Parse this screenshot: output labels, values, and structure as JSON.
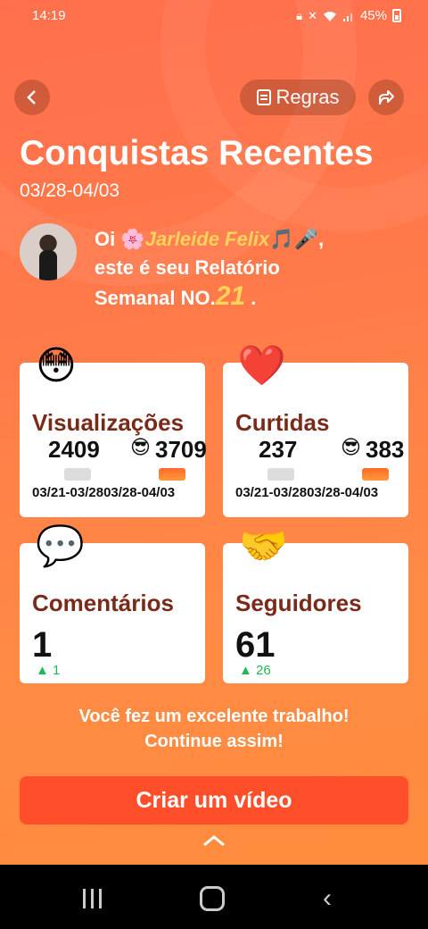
{
  "status_bar": {
    "time": "14:19",
    "battery": "45%",
    "icons": [
      "lock-icon",
      "mute-icon",
      "wifi-icon",
      "signal-icon",
      "battery-icon"
    ]
  },
  "nav": {
    "back_icon": "chevron-left-icon",
    "rules_label": "Regras",
    "share_icon": "share-icon"
  },
  "header": {
    "title": "Conquistas Recentes",
    "date_range": "03/28-04/03"
  },
  "greeting": {
    "hi": "Oi",
    "flower": "🌸",
    "name": "Jarleide Felix",
    "name_emojis": "🎵🎤",
    "comma": ",",
    "line2": "este é seu Relatório",
    "line3_prefix": "Semanal NO.",
    "week_number": "21",
    "period": "."
  },
  "cards": {
    "views": {
      "emoji": "😳",
      "label": "Visualizações",
      "prev": "2409",
      "curr_emoji": "😎",
      "curr": "3709",
      "dates": "03/21-03/2803/28-04/03"
    },
    "likes": {
      "emoji": "❤️",
      "label": "Curtidas",
      "prev": "237",
      "curr_emoji": "😎",
      "curr": "383",
      "dates": "03/21-03/2803/28-04/03"
    },
    "comments": {
      "emoji": "💬",
      "label": "Comentários",
      "value": "1",
      "delta": "▲ 1"
    },
    "followers": {
      "emoji": "🤝",
      "label": "Seguidores",
      "value": "61",
      "delta": "▲ 26"
    }
  },
  "message": {
    "line1": "Você fez um excelente trabalho!",
    "line2": "Continue assim!"
  },
  "cta": {
    "label": "Criar um vídeo"
  },
  "colors": {
    "accent": "#ff4f2a",
    "label_brown": "#7a2a18",
    "highlight": "#ffd25a",
    "up_green": "#1db954"
  }
}
